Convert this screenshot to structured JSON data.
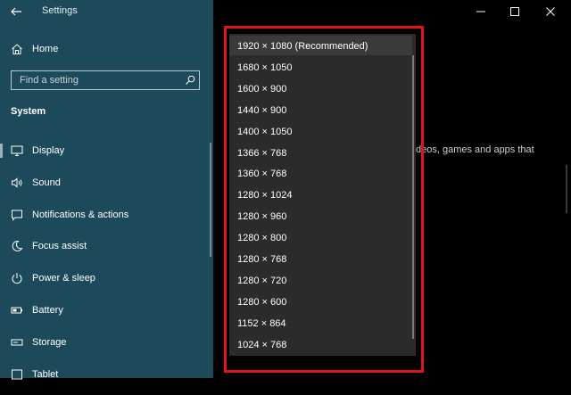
{
  "window": {
    "title": "Settings",
    "controls": {
      "minimize": "minimize-icon",
      "maximize": "maximize-icon",
      "close": "close-icon"
    }
  },
  "sidebar": {
    "home_label": "Home",
    "search_placeholder": "Find a setting",
    "section_title": "System",
    "items": [
      {
        "label": "Display",
        "icon": "monitor-icon"
      },
      {
        "label": "Sound",
        "icon": "speaker-icon"
      },
      {
        "label": "Notifications & actions",
        "icon": "notification-icon"
      },
      {
        "label": "Focus assist",
        "icon": "moon-icon"
      },
      {
        "label": "Power & sleep",
        "icon": "power-icon"
      },
      {
        "label": "Battery",
        "icon": "battery-icon"
      },
      {
        "label": "Storage",
        "icon": "storage-icon"
      },
      {
        "label": "Tablet",
        "icon": "tablet-icon"
      }
    ]
  },
  "content": {
    "partial_text": "deos, games and apps that"
  },
  "resolution_dropdown": {
    "options": [
      "1920 × 1080 (Recommended)",
      "1680 × 1050",
      "1600 × 900",
      "1440 × 900",
      "1400 × 1050",
      "1366 × 768",
      "1360 × 768",
      "1280 × 1024",
      "1280 × 960",
      "1280 × 800",
      "1280 × 768",
      "1280 × 720",
      "1280 × 600",
      "1152 × 864",
      "1024 × 768"
    ]
  },
  "colors": {
    "sidebar_bg": "#1d4a5a",
    "content_bg": "#000000",
    "dropdown_bg": "#2b2b2b",
    "highlight_frame": "#e0141b"
  }
}
